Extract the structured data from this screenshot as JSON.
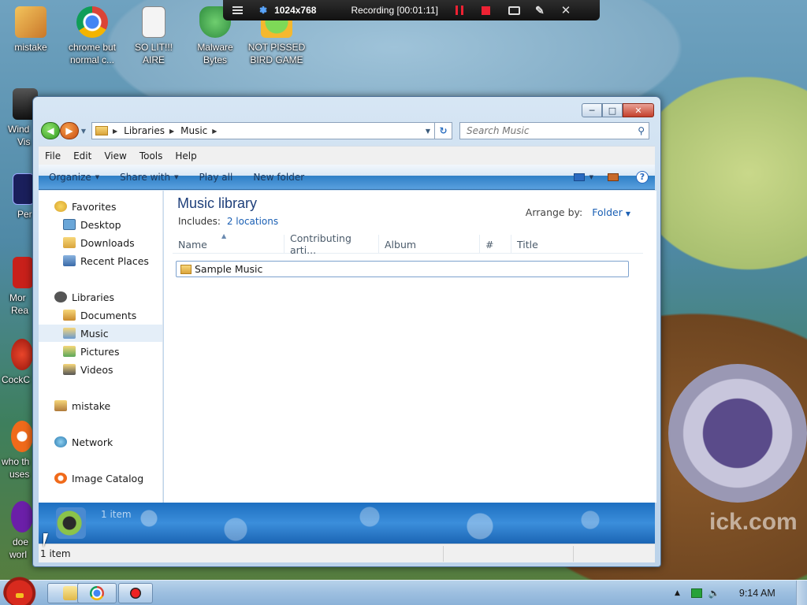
{
  "desktop": {
    "icons": [
      {
        "label": "mistake",
        "color": "#e8a23a"
      },
      {
        "label": "chrome but normal c...",
        "color": "#4285f4"
      },
      {
        "label": "SO LIT!!! AIRE",
        "color": "#f2f2f2"
      },
      {
        "label": "Malware Bytes",
        "color": "#2e8b3e"
      },
      {
        "label": "NOT PISSED BIRD GAME",
        "color": "#f5b82e"
      }
    ],
    "left_icons": [
      {
        "label": "Wind",
        "label2": "Vis"
      },
      {
        "label": "Per",
        "label2": ""
      },
      {
        "label": "Mor",
        "label2": "Rea"
      },
      {
        "label": "CockC",
        "label2": ""
      },
      {
        "label": "who th",
        "label2": "uses"
      },
      {
        "label": "doe",
        "label2": "worl"
      }
    ],
    "watermark": "ick.com"
  },
  "recording_bar": {
    "resolution": "1024x768",
    "status": "Recording [00:01:11]"
  },
  "window": {
    "address": {
      "crumbs": [
        "Libraries",
        "Music"
      ]
    },
    "search_placeholder": "Search Music",
    "menu": [
      "File",
      "Edit",
      "View",
      "Tools",
      "Help"
    ],
    "commands": {
      "organize": "Organize",
      "share_with": "Share with",
      "play_all": "Play all",
      "new_folder": "New folder",
      "help": "?"
    },
    "nav": {
      "favorites": "Favorites",
      "desktop": "Desktop",
      "downloads": "Downloads",
      "recent_places": "Recent Places",
      "libraries": "Libraries",
      "documents": "Documents",
      "music": "Music",
      "pictures": "Pictures",
      "videos": "Videos",
      "user": "mistake",
      "network": "Network",
      "image_catalog": "Image Catalog"
    },
    "library": {
      "title": "Music library",
      "includes_label": "Includes:",
      "includes_link": "2 locations",
      "arrange_label": "Arrange by:",
      "arrange_value": "Folder"
    },
    "columns": [
      "Name",
      "Contributing arti...",
      "Album",
      "#",
      "Title"
    ],
    "files": [
      {
        "name": "Sample Music"
      }
    ],
    "details_count": "1 item",
    "status_text": "1 item"
  },
  "taskbar": {
    "time": "9:14 AM"
  },
  "colors": {
    "title_blue": "#1e3f7a",
    "link_blue": "#1a5fb4",
    "record_red": "#e22233"
  }
}
